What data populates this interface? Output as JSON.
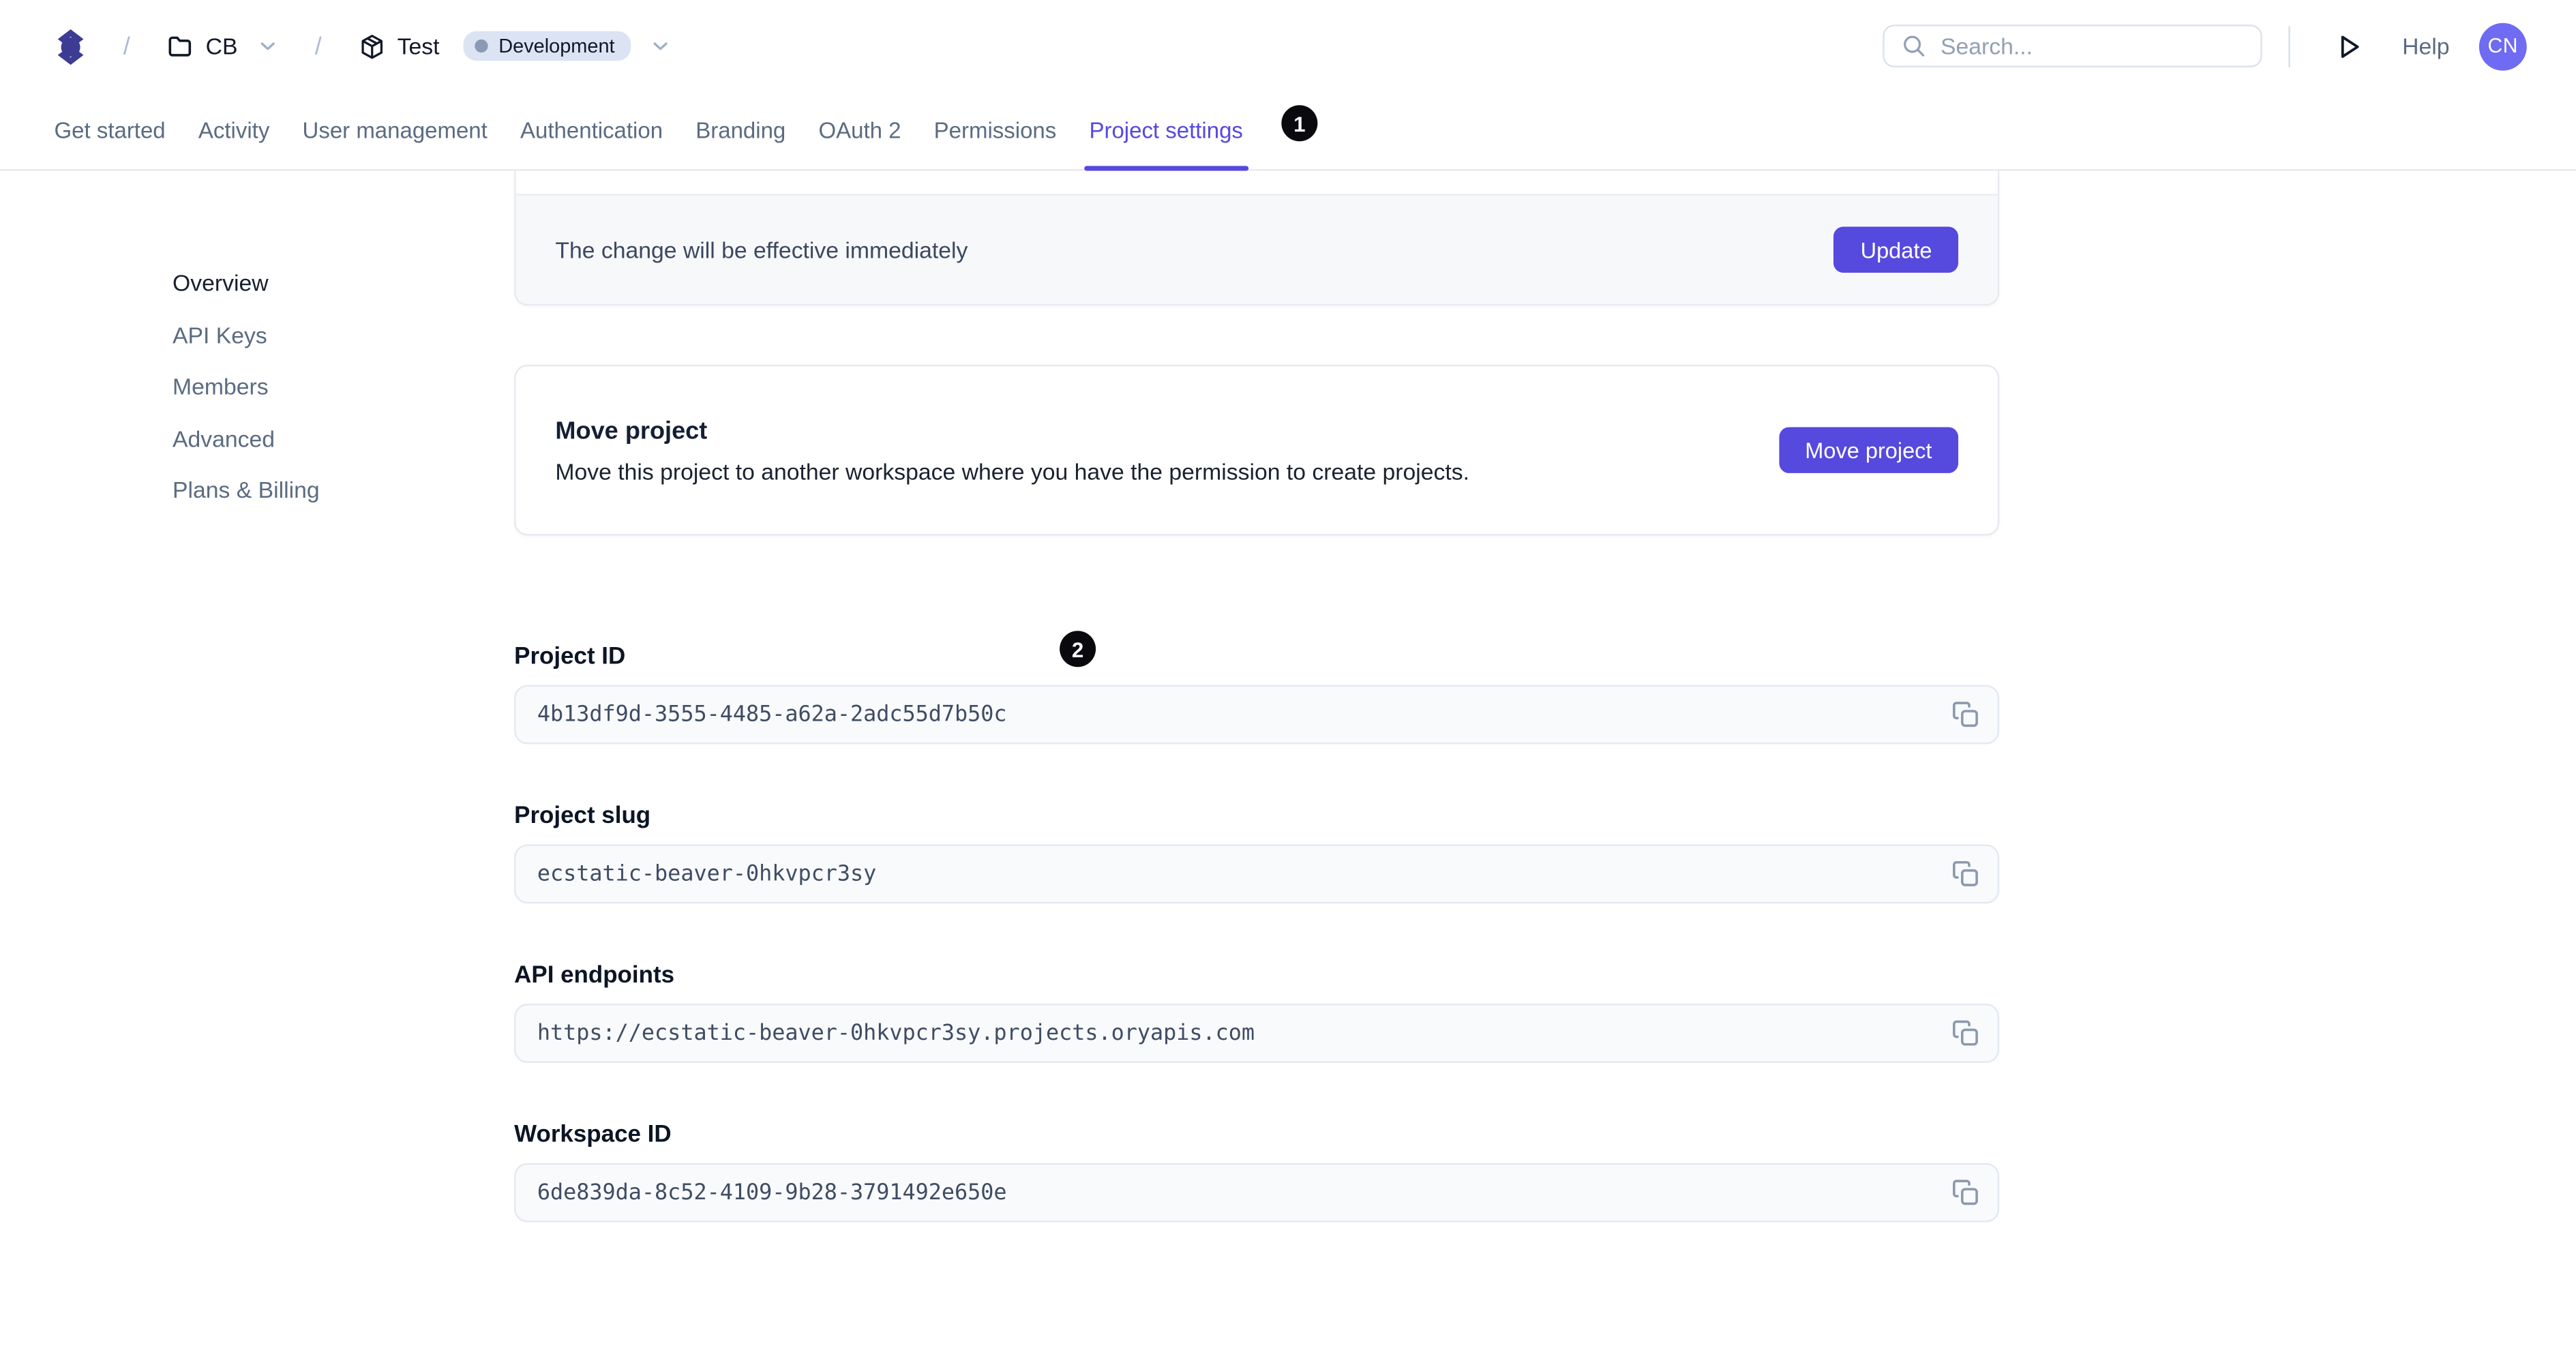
{
  "colors": {
    "accent": "#5649de",
    "avatar": "#6f6bf2",
    "logo": "#3c3c94",
    "badge-bg": "#dce3f2",
    "badge-dot": "#8a9ab5"
  },
  "header": {
    "breadcrumb": {
      "separator": "/",
      "workspace": "CB",
      "project": "Test",
      "environment": "Development"
    },
    "search": {
      "placeholder": "Search..."
    },
    "help_label": "Help",
    "avatar_initials": "CN"
  },
  "tabs": {
    "items": [
      {
        "label": "Get started"
      },
      {
        "label": "Activity"
      },
      {
        "label": "User management"
      },
      {
        "label": "Authentication"
      },
      {
        "label": "Branding"
      },
      {
        "label": "OAuth 2"
      },
      {
        "label": "Permissions"
      },
      {
        "label": "Project settings",
        "active": true
      }
    ]
  },
  "annotations": {
    "badge1": "1",
    "badge2": "2"
  },
  "sidebar": {
    "items": [
      {
        "label": "Overview",
        "active": true
      },
      {
        "label": "API Keys"
      },
      {
        "label": "Members"
      },
      {
        "label": "Advanced"
      },
      {
        "label": "Plans & Billing"
      }
    ]
  },
  "cards": {
    "update": {
      "message": "The change will be effective immediately",
      "button_label": "Update"
    },
    "move": {
      "title": "Move project",
      "description": "Move this project to another workspace where you have the permission to create projects.",
      "button_label": "Move project"
    }
  },
  "fields": [
    {
      "label": "Project ID",
      "value": "4b13df9d-3555-4485-a62a-2adc55d7b50c"
    },
    {
      "label": "Project slug",
      "value": "ecstatic-beaver-0hkvpcr3sy"
    },
    {
      "label": "API endpoints",
      "value": "https://ecstatic-beaver-0hkvpcr3sy.projects.oryapis.com"
    },
    {
      "label": "Workspace ID",
      "value": "6de839da-8c52-4109-9b28-3791492e650e"
    }
  ]
}
